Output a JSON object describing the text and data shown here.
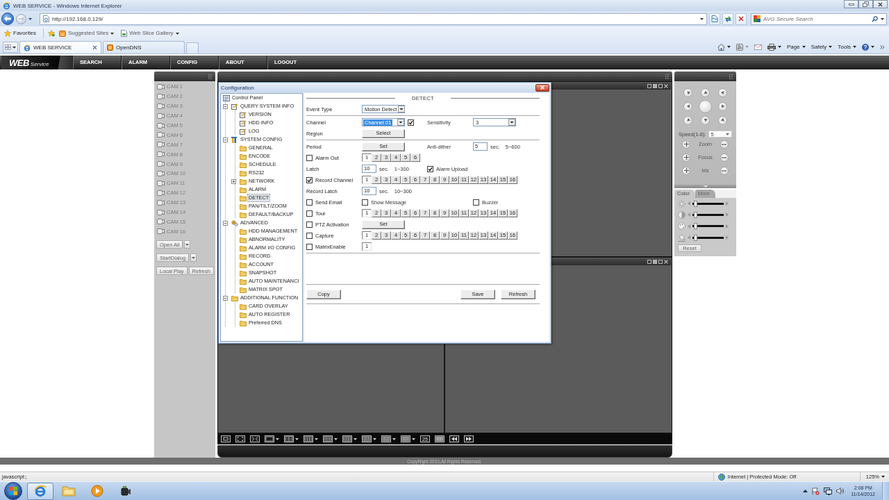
{
  "browser": {
    "title": "WEB SERVICE - Windows Internet Explorer",
    "url": "http://192.168.0.129/",
    "search_placeholder": "AVG Secure Search",
    "favorites": {
      "label": "Favorites",
      "links": [
        "Suggested Sites",
        "Web Slice Gallery"
      ]
    },
    "tabs": [
      {
        "label": "WEB SERVICE",
        "selected": true
      },
      {
        "label": "OpenDNS",
        "selected": false
      }
    ],
    "commands": [
      "Page",
      "Safety",
      "Tools"
    ]
  },
  "app": {
    "logo": {
      "main": "WEB",
      "sub": "Service"
    },
    "nav": [
      "SEARCH",
      "ALARM",
      "CONFIG",
      "ABOUT",
      "LOGOUT"
    ],
    "cameras": [
      "CAM 1",
      "CAM 2",
      "CAM 3",
      "CAM 4",
      "CAM 5",
      "CAM 6",
      "CAM 7",
      "CAM 8",
      "CAM 9",
      "CAM 10",
      "CAM 11",
      "CAM 12",
      "CAM 13",
      "CAM 14",
      "CAM 15",
      "CAM 16"
    ],
    "camera_buttons": [
      [
        {
          "label": "Open All",
          "dropdown": true
        }
      ],
      [
        {
          "label": "StartDialog",
          "dropdown": true
        }
      ],
      [
        {
          "label": "Local Play",
          "dropdown": false
        },
        {
          "label": "Refresh",
          "dropdown": false
        }
      ]
    ],
    "layout_buttons": [
      {
        "kind": "single",
        "dropdown": false
      },
      {
        "kind": "fit",
        "dropdown": false
      },
      {
        "kind": "fullscreen",
        "dropdown": false
      },
      {
        "kind": "one",
        "dropdown": true
      },
      {
        "kind": "four",
        "dropdown": true
      },
      {
        "kind": "six",
        "dropdown": true
      },
      {
        "kind": "eight",
        "dropdown": true
      },
      {
        "kind": "nine",
        "dropdown": true
      },
      {
        "kind": "thirteen",
        "dropdown": true
      },
      {
        "kind": "sixteen",
        "dropdown": true
      },
      {
        "kind": "twenty",
        "dropdown": true
      },
      {
        "kind": "number",
        "label": "25",
        "dropdown": false
      },
      {
        "kind": "thirtysix",
        "dropdown": false
      },
      {
        "kind": "prev",
        "dropdown": false
      },
      {
        "kind": "next",
        "dropdown": false
      }
    ],
    "ptz": {
      "speed_label": "Speed(1-8):",
      "speed": "5",
      "lens": [
        "Zoom",
        "Focus",
        "Iris"
      ],
      "tabs": [
        {
          "label": "Color",
          "selected": true
        },
        {
          "label": "More",
          "selected": false
        }
      ],
      "sliders": [
        {
          "kind": "brightness",
          "level": 0.05
        },
        {
          "kind": "contrast",
          "level": 0.05
        },
        {
          "kind": "saturation",
          "level": 0.05
        },
        {
          "kind": "hue",
          "level": 0.05
        }
      ],
      "reset": "Reset"
    },
    "copyright": "CopyRight 2010,All Rights Reserved."
  },
  "dialog": {
    "title": "Configuration",
    "tree": {
      "label": "Control Panel",
      "kind": "panel",
      "selected": false,
      "children": [
        {
          "label": "QUERY SYSTEM INFO",
          "kind": "note",
          "selected": false,
          "expanded": true,
          "children": [
            {
              "label": "VERSION",
              "kind": "note",
              "selected": false
            },
            {
              "label": "HDD INFO",
              "kind": "note",
              "selected": false
            },
            {
              "label": "LOG",
              "kind": "note",
              "selected": false
            }
          ]
        },
        {
          "label": "SYSTEM CONFIG",
          "kind": "tools",
          "selected": false,
          "expanded": true,
          "children": [
            {
              "label": "GENERAL",
              "kind": "folder",
              "selected": false
            },
            {
              "label": "ENCODE",
              "kind": "folder",
              "selected": false
            },
            {
              "label": "SCHEDULE",
              "kind": "folder",
              "selected": false
            },
            {
              "label": "RS232",
              "kind": "folder",
              "selected": false
            },
            {
              "label": "NETWORK",
              "kind": "folder",
              "selected": false,
              "expanded": false
            },
            {
              "label": "ALARM",
              "kind": "folder",
              "selected": false
            },
            {
              "label": "DETECT",
              "kind": "folder",
              "selected": true
            },
            {
              "label": "PAN/TILT/ZOOM",
              "kind": "folder",
              "selected": false
            },
            {
              "label": "DEFAULT/BACKUP",
              "kind": "folder",
              "selected": false
            }
          ]
        },
        {
          "label": "ADVANCED",
          "kind": "gears",
          "selected": false,
          "expanded": true,
          "children": [
            {
              "label": "HDD MANAGEMENT",
              "kind": "folder",
              "selected": false
            },
            {
              "label": "ABNORMALITY",
              "kind": "folder",
              "selected": false
            },
            {
              "label": "ALARM I/O CONFIG",
              "kind": "folder",
              "selected": false
            },
            {
              "label": "RECORD",
              "kind": "folder",
              "selected": false
            },
            {
              "label": "ACCOUNT",
              "kind": "folder",
              "selected": false
            },
            {
              "label": "SNAPSHOT",
              "kind": "folder",
              "selected": false
            },
            {
              "label": "AUTO MAINTENANCI",
              "kind": "folder",
              "selected": false
            },
            {
              "label": "MATRIX SPOT",
              "kind": "folder",
              "selected": false
            }
          ]
        },
        {
          "label": "ADDITIONAL FUNCTION",
          "kind": "folder",
          "selected": false,
          "expanded": true,
          "children": [
            {
              "label": "CARD OVERLAY",
              "kind": "folder",
              "selected": false
            },
            {
              "label": "AUTO REGISTER",
              "kind": "folder",
              "selected": false
            },
            {
              "label": "Preferred DNS",
              "kind": "folder",
              "selected": false
            }
          ]
        }
      ]
    },
    "heading": "DETECT",
    "groups": [
      [
        {
          "kind": "plain",
          "label": "Event Type",
          "main": [
            {
              "kind": "select",
              "value": "Motion Detect",
              "highlighted": false
            }
          ]
        }
      ],
      [
        {
          "kind": "plain",
          "label": "Channel",
          "main": [
            {
              "kind": "select",
              "value": "Channel 01",
              "highlighted": true
            },
            {
              "kind": "checkbox",
              "checked": true
            }
          ],
          "side": [
            {
              "kind": "label",
              "text": "Sensitivity"
            }
          ],
          "far": [
            {
              "kind": "select",
              "value": "3",
              "highlighted": false
            }
          ]
        },
        {
          "kind": "plain",
          "label": "Region",
          "main": [
            {
              "kind": "button",
              "label": "Select"
            }
          ]
        }
      ],
      [
        {
          "kind": "plain",
          "label": "Period",
          "main": [
            {
              "kind": "button",
              "label": "Set"
            }
          ],
          "side": [
            {
              "kind": "label",
              "text": "Anti-dither"
            }
          ],
          "far": [
            {
              "kind": "input",
              "value": "5"
            },
            {
              "kind": "unit",
              "text": "sec."
            },
            {
              "kind": "range",
              "text": "5~600"
            }
          ]
        },
        {
          "kind": "check",
          "label": "Alarm Out",
          "checked": false,
          "main": [
            {
              "kind": "channels",
              "items": [
                {
                  "label": "1",
                  "selected": true
                },
                {
                  "label": "2",
                  "selected": false
                },
                {
                  "label": "3",
                  "selected": false
                },
                {
                  "label": "4",
                  "selected": false
                },
                {
                  "label": "5",
                  "selected": false
                },
                {
                  "label": "6",
                  "selected": false
                }
              ]
            }
          ]
        },
        {
          "kind": "plain",
          "label": "Latch",
          "main": [
            {
              "kind": "input",
              "value": "10"
            },
            {
              "kind": "unit",
              "text": "sec."
            },
            {
              "kind": "range",
              "text": "1~300"
            }
          ],
          "side": [
            {
              "kind": "checkbox",
              "checked": true,
              "label": "Alarm Upload"
            }
          ]
        },
        {
          "kind": "check",
          "label": "Record Channel",
          "checked": true,
          "main": [
            {
              "kind": "channels",
              "items": [
                {
                  "label": "1",
                  "selected": true
                },
                {
                  "label": "2",
                  "selected": false
                },
                {
                  "label": "3",
                  "selected": false
                },
                {
                  "label": "4",
                  "selected": false
                },
                {
                  "label": "5",
                  "selected": false
                },
                {
                  "label": "6",
                  "selected": false
                },
                {
                  "label": "7",
                  "selected": false
                },
                {
                  "label": "8",
                  "selected": false
                },
                {
                  "label": "9",
                  "selected": false
                },
                {
                  "label": "10",
                  "selected": false
                },
                {
                  "label": "11",
                  "selected": false
                },
                {
                  "label": "12",
                  "selected": false
                },
                {
                  "label": "13",
                  "selected": false
                },
                {
                  "label": "14",
                  "selected": false
                },
                {
                  "label": "15",
                  "selected": false
                },
                {
                  "label": "16",
                  "selected": false
                }
              ]
            }
          ]
        },
        {
          "kind": "plain",
          "label": "Record Latch",
          "main": [
            {
              "kind": "input",
              "value": "10"
            },
            {
              "kind": "unit",
              "text": "sec."
            },
            {
              "kind": "range",
              "text": "10~300"
            }
          ]
        },
        {
          "kind": "check",
          "label": "Send Email",
          "checked": false,
          "main": [
            {
              "kind": "checkbox",
              "checked": false,
              "label": "Show Message"
            }
          ],
          "far": [
            {
              "kind": "checkbox",
              "checked": false,
              "label": "Buzzer"
            }
          ]
        },
        {
          "kind": "check",
          "label": "Tour",
          "checked": false,
          "main": [
            {
              "kind": "channels",
              "items": [
                {
                  "label": "1",
                  "selected": true
                },
                {
                  "label": "2",
                  "selected": false
                },
                {
                  "label": "3",
                  "selected": false
                },
                {
                  "label": "4",
                  "selected": false
                },
                {
                  "label": "5",
                  "selected": false
                },
                {
                  "label": "6",
                  "selected": false
                },
                {
                  "label": "7",
                  "selected": false
                },
                {
                  "label": "8",
                  "selected": false
                },
                {
                  "label": "9",
                  "selected": false
                },
                {
                  "label": "10",
                  "selected": false
                },
                {
                  "label": "11",
                  "selected": false
                },
                {
                  "label": "12",
                  "selected": false
                },
                {
                  "label": "13",
                  "selected": false
                },
                {
                  "label": "14",
                  "selected": false
                },
                {
                  "label": "15",
                  "selected": false
                },
                {
                  "label": "16",
                  "selected": false
                }
              ]
            }
          ]
        },
        {
          "kind": "check",
          "label": "PTZ Activation",
          "checked": false,
          "main": [
            {
              "kind": "button",
              "label": "Set"
            }
          ]
        },
        {
          "kind": "check",
          "label": "Capture",
          "checked": false,
          "main": [
            {
              "kind": "channels",
              "items": [
                {
                  "label": "1",
                  "selected": true
                },
                {
                  "label": "2",
                  "selected": false
                },
                {
                  "label": "3",
                  "selected": false
                },
                {
                  "label": "4",
                  "selected": false
                },
                {
                  "label": "5",
                  "selected": false
                },
                {
                  "label": "6",
                  "selected": false
                },
                {
                  "label": "7",
                  "selected": false
                },
                {
                  "label": "8",
                  "selected": false
                },
                {
                  "label": "9",
                  "selected": false
                },
                {
                  "label": "10",
                  "selected": false
                },
                {
                  "label": "11",
                  "selected": false
                },
                {
                  "label": "12",
                  "selected": false
                },
                {
                  "label": "13",
                  "selected": false
                },
                {
                  "label": "14",
                  "selected": false
                },
                {
                  "label": "15",
                  "selected": false
                },
                {
                  "label": "16",
                  "selected": false
                }
              ]
            }
          ]
        },
        {
          "kind": "check",
          "label": "MatrixEnable",
          "checked": false,
          "main": [
            {
              "kind": "channels",
              "items": [
                {
                  "label": "1",
                  "selected": true
                }
              ]
            }
          ]
        }
      ]
    ],
    "left_buttons": [
      "Copy"
    ],
    "right_buttons": [
      "Save",
      "Refresh"
    ]
  },
  "status_bar": {
    "text": "javascript:;",
    "zone": "Internet | Protected Mode: Off",
    "zoom": "125%"
  },
  "taskbar": {
    "apps": [
      {
        "kind": "browser",
        "active": true
      },
      {
        "kind": "folder",
        "active": false
      },
      {
        "kind": "media",
        "active": false
      },
      {
        "kind": "camera",
        "active": false
      }
    ],
    "time": "2:08 PM",
    "date": "11/14/2012"
  }
}
